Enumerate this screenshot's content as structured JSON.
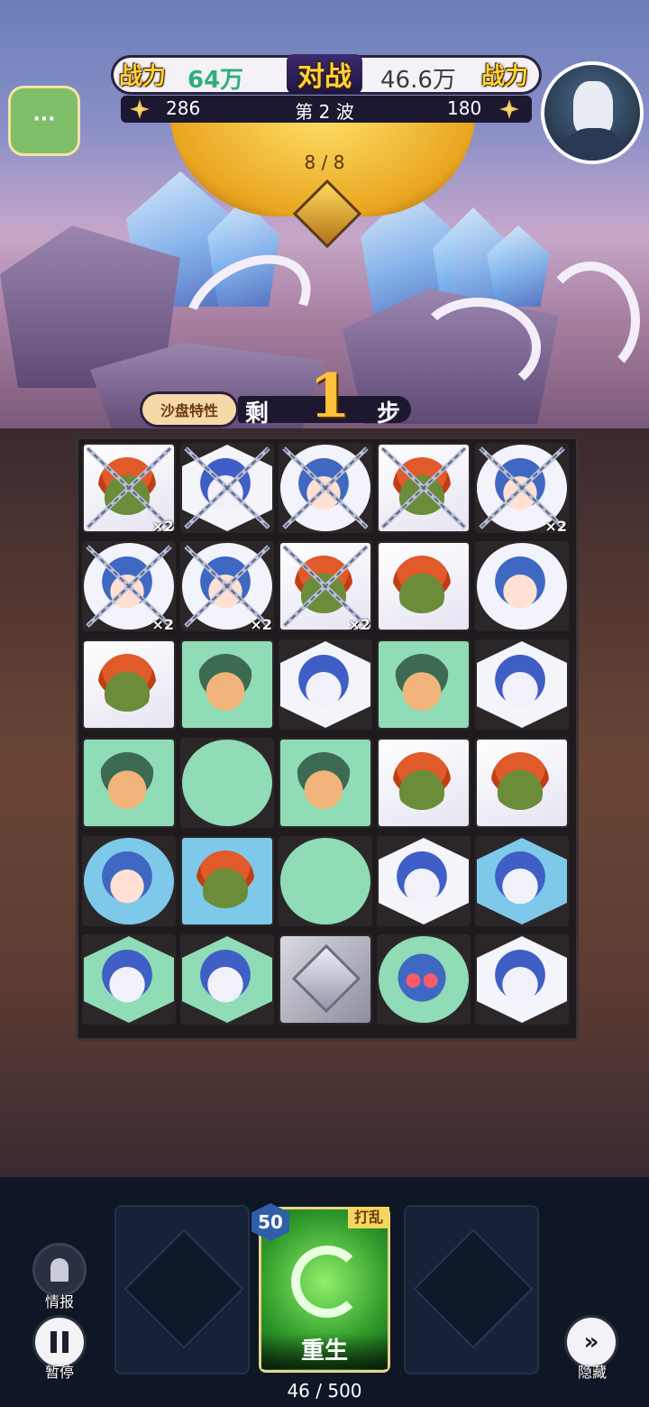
{
  "header": {
    "left_power_label": "战力",
    "left_power_value": "64万",
    "vs_label": "对战",
    "right_power_value": "46.6万",
    "right_power_label": "战力",
    "left_gems": "286",
    "wave": "第 2 波",
    "right_gems": "180",
    "left_avatar_menu": "···",
    "progress": "8 / 8"
  },
  "steps": {
    "trait_label": "沙盘特性",
    "prefix": "剩",
    "value": "1",
    "suffix": "步"
  },
  "board": {
    "rows": [
      [
        {
          "tile": "sq-white",
          "face": "orange",
          "chain": true,
          "mult": "×2"
        },
        {
          "tile": "hex-white",
          "face": "blue",
          "chain": true,
          "mult": ""
        },
        {
          "tile": "circ-white",
          "face": "girl",
          "chain": true,
          "mult": ""
        },
        {
          "tile": "sq-white",
          "face": "orange",
          "chain": true,
          "mult": ""
        },
        {
          "tile": "circ-white",
          "face": "girl",
          "chain": true,
          "mult": "×2"
        }
      ],
      [
        {
          "tile": "circ-white",
          "face": "girl",
          "chain": true,
          "mult": "×2"
        },
        {
          "tile": "circ-white",
          "face": "girl",
          "chain": true,
          "mult": "×2"
        },
        {
          "tile": "sq-white",
          "face": "orange",
          "chain": true,
          "mult": "×2"
        },
        {
          "tile": "sq-white",
          "face": "orange",
          "chain": false,
          "mult": ""
        },
        {
          "tile": "circ-white",
          "face": "girl",
          "chain": false,
          "mult": ""
        }
      ],
      [
        {
          "tile": "sq-white",
          "face": "orange",
          "chain": false,
          "mult": ""
        },
        {
          "tile": "sq-green",
          "face": "green",
          "chain": false,
          "mult": ""
        },
        {
          "tile": "hex-white",
          "face": "blue",
          "chain": false,
          "mult": ""
        },
        {
          "tile": "sq-green",
          "face": "green",
          "chain": false,
          "mult": ""
        },
        {
          "tile": "hex-white",
          "face": "blue",
          "chain": false,
          "mult": ""
        }
      ],
      [
        {
          "tile": "sq-green",
          "face": "green",
          "chain": false,
          "mult": ""
        },
        {
          "tile": "circ-green",
          "face": "",
          "chain": false,
          "mult": ""
        },
        {
          "tile": "sq-green",
          "face": "green",
          "chain": false,
          "mult": ""
        },
        {
          "tile": "sq-white",
          "face": "orange",
          "chain": false,
          "mult": ""
        },
        {
          "tile": "sq-white",
          "face": "orange",
          "chain": false,
          "mult": ""
        }
      ],
      [
        {
          "tile": "circ-blue",
          "face": "girl",
          "chain": false,
          "mult": ""
        },
        {
          "tile": "sq-blue",
          "face": "orange",
          "chain": false,
          "mult": ""
        },
        {
          "tile": "circ-green",
          "face": "",
          "chain": false,
          "mult": ""
        },
        {
          "tile": "hex-white",
          "face": "blue",
          "chain": false,
          "mult": ""
        },
        {
          "tile": "hex-blue",
          "face": "blue",
          "chain": false,
          "mult": ""
        }
      ],
      [
        {
          "tile": "hex-green",
          "face": "blue",
          "chain": false,
          "mult": ""
        },
        {
          "tile": "hex-green",
          "face": "blue",
          "chain": false,
          "mult": ""
        },
        {
          "tile": "stone",
          "face": "gem",
          "chain": false,
          "mult": ""
        },
        {
          "tile": "circ-green",
          "face": "goggle",
          "chain": false,
          "mult": ""
        },
        {
          "tile": "hex-white",
          "face": "blue",
          "chain": false,
          "mult": ""
        }
      ]
    ]
  },
  "skill_bar": {
    "card_cost": "50",
    "card_tag": "打乱",
    "card_name": "重生",
    "energy": "46 / 500"
  },
  "controls": {
    "info_label": "情报",
    "pause_label": "暂停",
    "hide_label": "隐藏"
  },
  "colors": {
    "power_left": "#2fae7e",
    "power_right": "#3a3a3a",
    "gold": "#ffd23a"
  }
}
